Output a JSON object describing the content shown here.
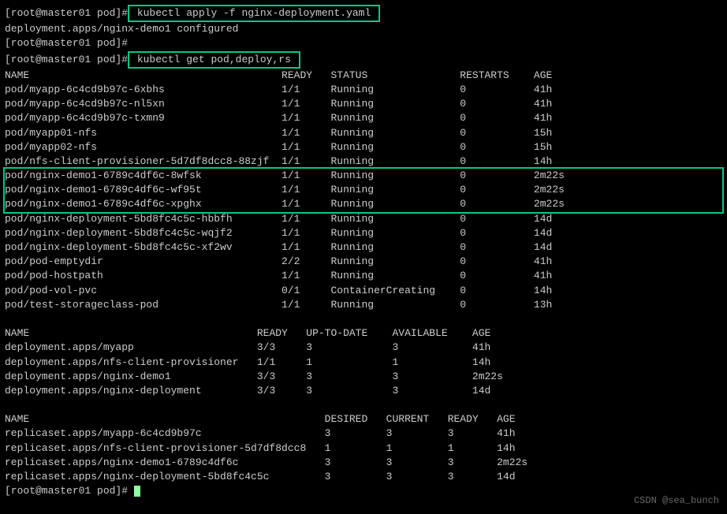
{
  "prompt": "[root@master01 pod]#",
  "cmd1": " kubectl apply -f nginx-deployment.yaml ",
  "apply_output": "deployment.apps/nginx-demo1 configured",
  "cmd2": " kubectl get pod,deploy,rs ",
  "pods_header": {
    "name": "NAME",
    "ready": "READY",
    "status": "STATUS",
    "restarts": "RESTARTS",
    "age": "AGE"
  },
  "pods": [
    {
      "name": "pod/myapp-6c4cd9b97c-6xbhs",
      "ready": "1/1",
      "status": "Running",
      "restarts": "0",
      "age": "41h"
    },
    {
      "name": "pod/myapp-6c4cd9b97c-nl5xn",
      "ready": "1/1",
      "status": "Running",
      "restarts": "0",
      "age": "41h"
    },
    {
      "name": "pod/myapp-6c4cd9b97c-txmn9",
      "ready": "1/1",
      "status": "Running",
      "restarts": "0",
      "age": "41h"
    },
    {
      "name": "pod/myapp01-nfs",
      "ready": "1/1",
      "status": "Running",
      "restarts": "0",
      "age": "15h"
    },
    {
      "name": "pod/myapp02-nfs",
      "ready": "1/1",
      "status": "Running",
      "restarts": "0",
      "age": "15h"
    },
    {
      "name": "pod/nfs-client-provisioner-5d7df8dcc8-88zjf",
      "ready": "1/1",
      "status": "Running",
      "restarts": "0",
      "age": "14h"
    }
  ],
  "pods_hl": [
    {
      "name": "pod/nginx-demo1-6789c4df6c-8wfsk",
      "ready": "1/1",
      "status": "Running",
      "restarts": "0",
      "age": "2m22s"
    },
    {
      "name": "pod/nginx-demo1-6789c4df6c-wf95t",
      "ready": "1/1",
      "status": "Running",
      "restarts": "0",
      "age": "2m22s"
    },
    {
      "name": "pod/nginx-demo1-6789c4df6c-xpghx",
      "ready": "1/1",
      "status": "Running",
      "restarts": "0",
      "age": "2m22s"
    }
  ],
  "pods2": [
    {
      "name": "pod/nginx-deployment-5bd8fc4c5c-hbbfh",
      "ready": "1/1",
      "status": "Running",
      "restarts": "0",
      "age": "14d"
    },
    {
      "name": "pod/nginx-deployment-5bd8fc4c5c-wqjf2",
      "ready": "1/1",
      "status": "Running",
      "restarts": "0",
      "age": "14d"
    },
    {
      "name": "pod/nginx-deployment-5bd8fc4c5c-xf2wv",
      "ready": "1/1",
      "status": "Running",
      "restarts": "0",
      "age": "14d"
    },
    {
      "name": "pod/pod-emptydir",
      "ready": "2/2",
      "status": "Running",
      "restarts": "0",
      "age": "41h"
    },
    {
      "name": "pod/pod-hostpath",
      "ready": "1/1",
      "status": "Running",
      "restarts": "0",
      "age": "41h"
    },
    {
      "name": "pod/pod-vol-pvc",
      "ready": "0/1",
      "status": "ContainerCreating",
      "restarts": "0",
      "age": "14h"
    },
    {
      "name": "pod/test-storageclass-pod",
      "ready": "1/1",
      "status": "Running",
      "restarts": "0",
      "age": "13h"
    }
  ],
  "dep_header": {
    "name": "NAME",
    "ready": "READY",
    "utd": "UP-TO-DATE",
    "avail": "AVAILABLE",
    "age": "AGE"
  },
  "deps": [
    {
      "name": "deployment.apps/myapp",
      "ready": "3/3",
      "utd": "3",
      "avail": "3",
      "age": "41h"
    },
    {
      "name": "deployment.apps/nfs-client-provisioner",
      "ready": "1/1",
      "utd": "1",
      "avail": "1",
      "age": "14h"
    },
    {
      "name": "deployment.apps/nginx-demo1",
      "ready": "3/3",
      "utd": "3",
      "avail": "3",
      "age": "2m22s"
    },
    {
      "name": "deployment.apps/nginx-deployment",
      "ready": "3/3",
      "utd": "3",
      "avail": "3",
      "age": "14d"
    }
  ],
  "rs_header": {
    "name": "NAME",
    "desired": "DESIRED",
    "current": "CURRENT",
    "ready": "READY",
    "age": "AGE"
  },
  "rss": [
    {
      "name": "replicaset.apps/myapp-6c4cd9b97c",
      "desired": "3",
      "current": "3",
      "ready": "3",
      "age": "41h"
    },
    {
      "name": "replicaset.apps/nfs-client-provisioner-5d7df8dcc8",
      "desired": "1",
      "current": "1",
      "ready": "1",
      "age": "14h"
    },
    {
      "name": "replicaset.apps/nginx-demo1-6789c4df6c",
      "desired": "3",
      "current": "3",
      "ready": "3",
      "age": "2m22s"
    },
    {
      "name": "replicaset.apps/nginx-deployment-5bd8fc4c5c",
      "desired": "3",
      "current": "3",
      "ready": "3",
      "age": "14d"
    }
  ],
  "watermark": "CSDN @sea_bunch"
}
